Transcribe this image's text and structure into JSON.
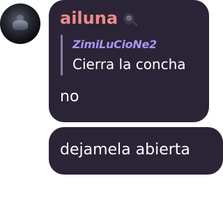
{
  "avatar": {
    "icon": "user-avatar"
  },
  "message": {
    "author": "ailuna",
    "author_color": "#f08a8a",
    "badge_icon": "rose-icon",
    "reply": {
      "author": "ZimiLuCioNe2",
      "author_color": "#a895f0",
      "text": "Cierra la concha"
    },
    "text": "no"
  },
  "followup": {
    "text": "dejamela abierta"
  },
  "colors": {
    "bubble_background": "#2a2436",
    "text": "#ffffff",
    "page_background": "#ffffff"
  }
}
